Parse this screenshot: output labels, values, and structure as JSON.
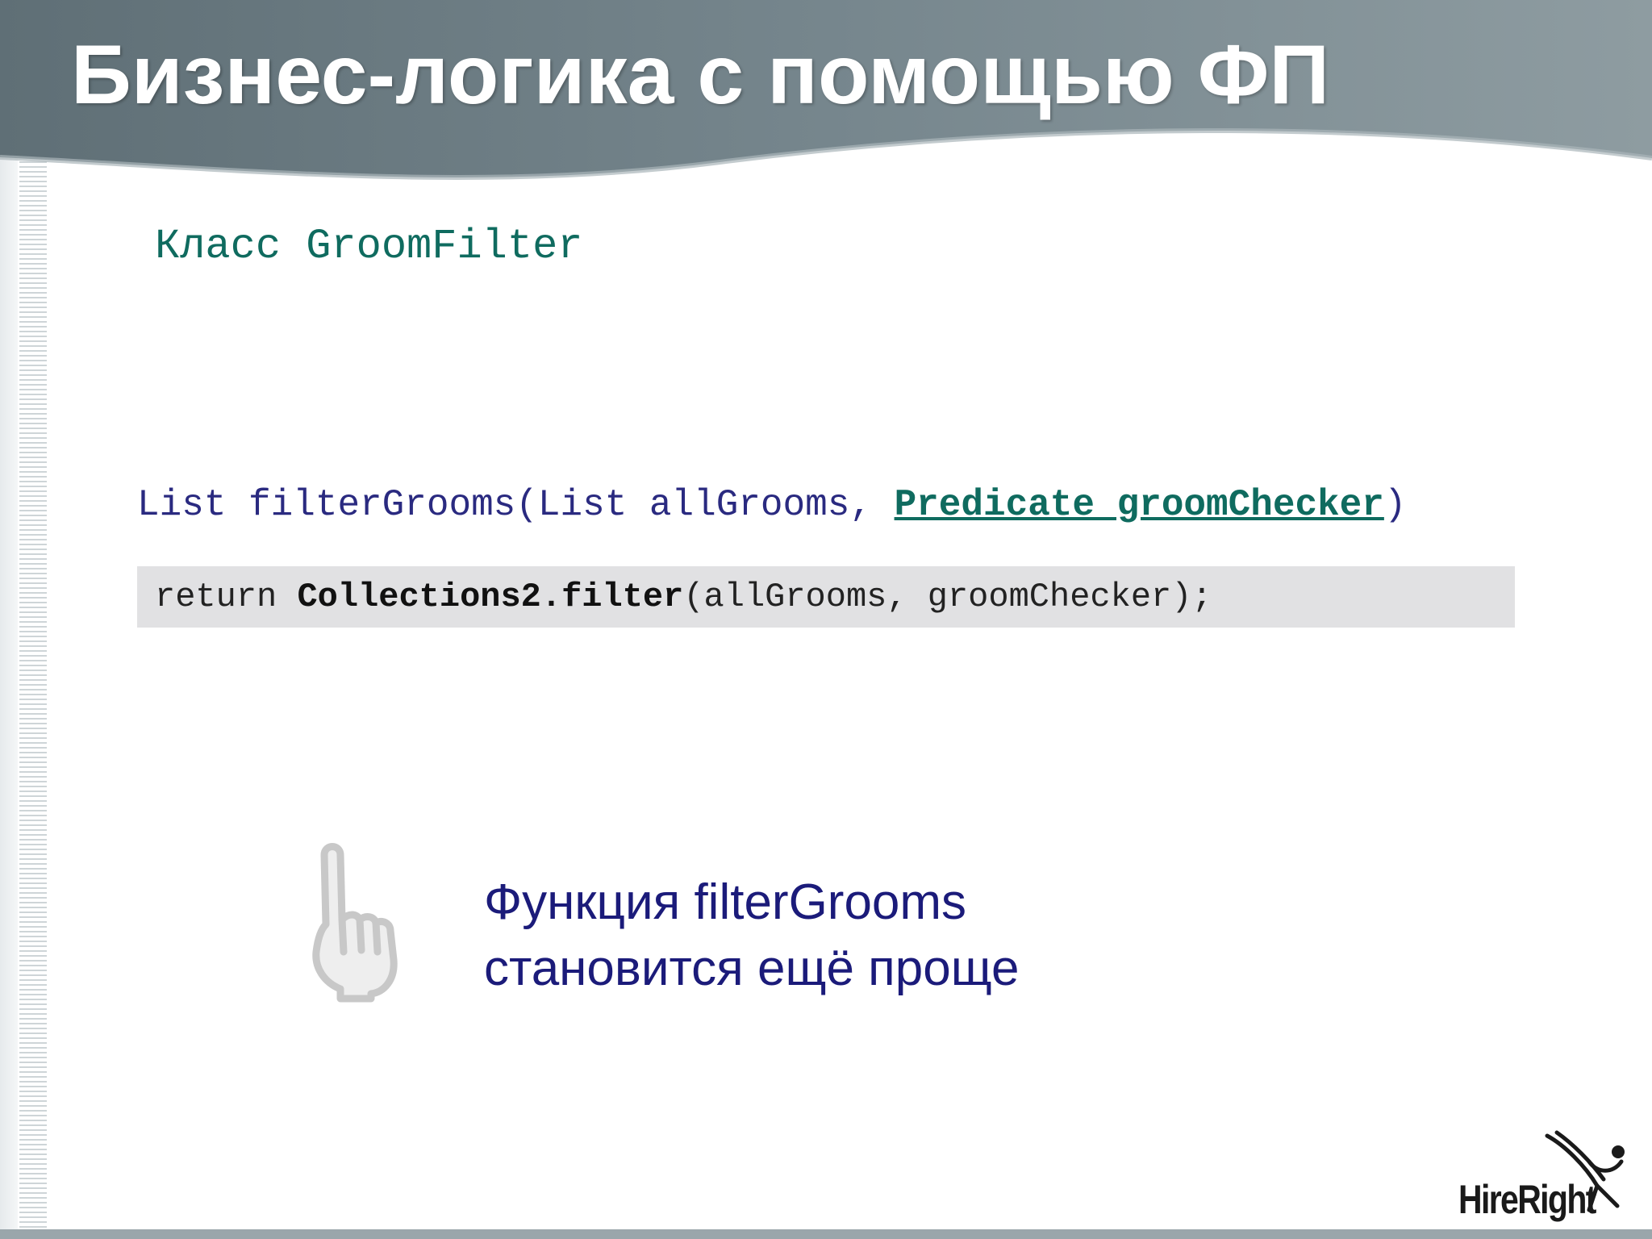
{
  "slide": {
    "title": "Бизнес-логика с помощью ФП",
    "class_caption": "Класс GroomFilter",
    "signature": {
      "prefix": "List filterGrooms(List allGrooms, ",
      "link": "Predicate groomChecker",
      "suffix": ")"
    },
    "code": {
      "keyword": "return ",
      "call": "Collections2.filter",
      "args": "(allGrooms, groomChecker);"
    },
    "callout": {
      "line1": "Функция filterGrooms",
      "line2": "становится ещё проще"
    },
    "icons": {
      "pointer": "pointing-hand-icon",
      "logo": "hireright-logo"
    },
    "logo_text": "HireRight",
    "colors": {
      "title": "#ffffff",
      "header": "#6f7f86",
      "caption": "#0f6b5f",
      "signature": "#2a2a80",
      "code_bg": "#e1e1e3",
      "callout": "#1b1b7a"
    }
  }
}
